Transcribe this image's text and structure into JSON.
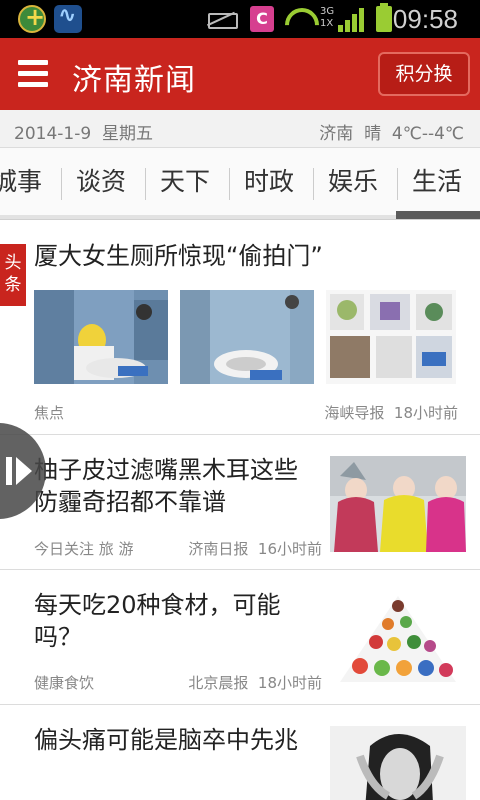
{
  "status_bar": {
    "time": "09:58",
    "network_type": "3G\n1X",
    "notification_c_label": "C"
  },
  "header": {
    "title": "济南新闻",
    "points_button_label": "积分换"
  },
  "info_bar": {
    "date": "2014-1-9  星期五",
    "weather": "济南  晴  4℃--4℃"
  },
  "tabs": [
    {
      "label": "城事"
    },
    {
      "label": "谈资"
    },
    {
      "label": "天下"
    },
    {
      "label": "时政"
    },
    {
      "label": "娱乐"
    },
    {
      "label": "生活"
    }
  ],
  "active_tab": "生活",
  "feed": {
    "headline_badge": "头\n条",
    "items": [
      {
        "title": "厦大女生厕所惊现“偷拍门”",
        "category": "焦点",
        "source_time": "海峡导报  18小时前",
        "thumbnails": [
          "toilet-photo-1",
          "toilet-photo-2",
          "device-photos-collage"
        ]
      },
      {
        "title": "柚子皮过滤嘴黑木耳这些防霾奇招都不靠谱",
        "category": "今日关注 旅 游",
        "source_time": "济南日报  16小时前",
        "thumbnails": [
          "masked-women-photo"
        ]
      },
      {
        "title": "每天吃20种食材，可能吗？",
        "category": "健康食饮",
        "source_time": "北京晨报  18小时前",
        "thumbnails": [
          "food-pyramid-image"
        ]
      },
      {
        "title": "偏头痛可能是脑卒中先兆",
        "category": "",
        "source_time": "",
        "thumbnails": [
          "headache-woman-photo"
        ]
      }
    ]
  },
  "colors": {
    "brand_red": "#c9251e",
    "tab_active": "#5b5b5b",
    "meta_text": "#888888"
  }
}
